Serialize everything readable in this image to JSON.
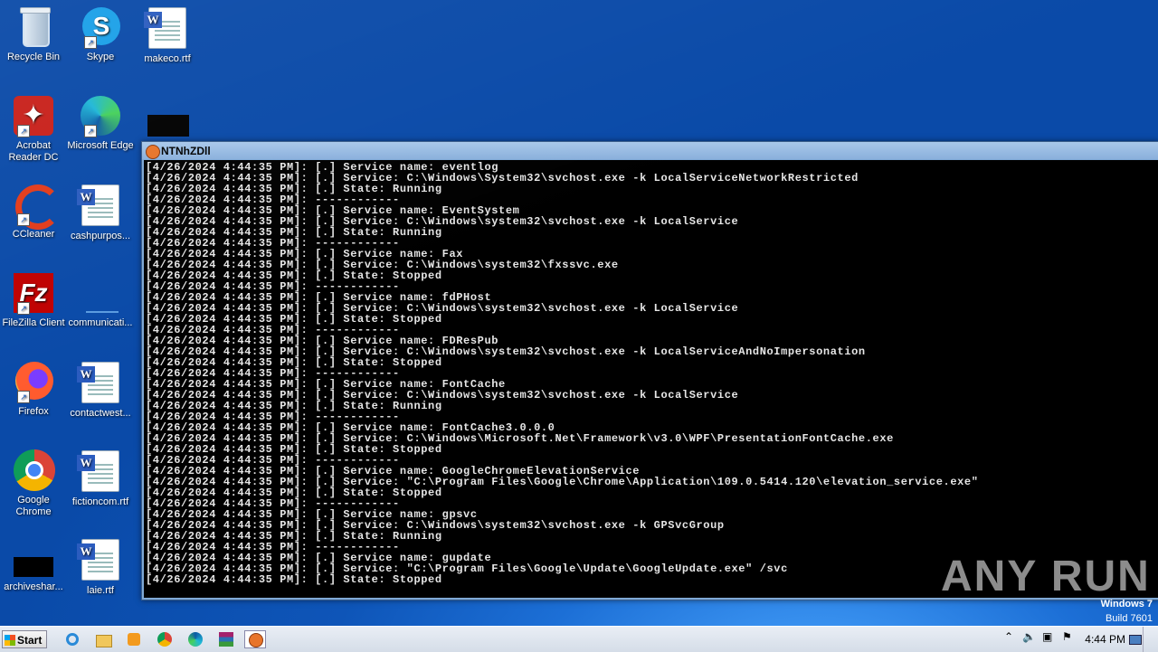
{
  "desktop_icons": {
    "recycle_bin": "Recycle Bin",
    "skype": "Skype",
    "makeco": "makeco.rtf",
    "acrobat": "Acrobat Reader DC",
    "edge": "Microsoft Edge",
    "ccleaner": "CCleaner",
    "cashpurpos": "cashpurpos...",
    "filezilla": "FileZilla Client",
    "communicati": "communicati...",
    "firefox": "Firefox",
    "contactwest": "contactwest...",
    "chrome": "Google Chrome",
    "fictioncom": "fictioncom.rtf",
    "archiveshar": "archiveshar...",
    "laie": "laie.rtf"
  },
  "window": {
    "title": "NTNhZDll",
    "console_text": "[4/26/2024 4:44:35 PM]: [.] Service name: eventlog\n[4/26/2024 4:44:35 PM]: [.] Service: C:\\Windows\\System32\\svchost.exe -k LocalServiceNetworkRestricted\n[4/26/2024 4:44:35 PM]: [.] State: Running\n[4/26/2024 4:44:35 PM]: ------------\n[4/26/2024 4:44:35 PM]: [.] Service name: EventSystem\n[4/26/2024 4:44:35 PM]: [.] Service: C:\\Windows\\system32\\svchost.exe -k LocalService\n[4/26/2024 4:44:35 PM]: [.] State: Running\n[4/26/2024 4:44:35 PM]: ------------\n[4/26/2024 4:44:35 PM]: [.] Service name: Fax\n[4/26/2024 4:44:35 PM]: [.] Service: C:\\Windows\\system32\\fxssvc.exe\n[4/26/2024 4:44:35 PM]: [.] State: Stopped\n[4/26/2024 4:44:35 PM]: ------------\n[4/26/2024 4:44:35 PM]: [.] Service name: fdPHost\n[4/26/2024 4:44:35 PM]: [.] Service: C:\\Windows\\system32\\svchost.exe -k LocalService\n[4/26/2024 4:44:35 PM]: [.] State: Stopped\n[4/26/2024 4:44:35 PM]: ------------\n[4/26/2024 4:44:35 PM]: [.] Service name: FDResPub\n[4/26/2024 4:44:35 PM]: [.] Service: C:\\Windows\\system32\\svchost.exe -k LocalServiceAndNoImpersonation\n[4/26/2024 4:44:35 PM]: [.] State: Stopped\n[4/26/2024 4:44:35 PM]: ------------\n[4/26/2024 4:44:35 PM]: [.] Service name: FontCache\n[4/26/2024 4:44:35 PM]: [.] Service: C:\\Windows\\system32\\svchost.exe -k LocalService\n[4/26/2024 4:44:35 PM]: [.] State: Running\n[4/26/2024 4:44:35 PM]: ------------\n[4/26/2024 4:44:35 PM]: [.] Service name: FontCache3.0.0.0\n[4/26/2024 4:44:35 PM]: [.] Service: C:\\Windows\\Microsoft.Net\\Framework\\v3.0\\WPF\\PresentationFontCache.exe\n[4/26/2024 4:44:35 PM]: [.] State: Stopped\n[4/26/2024 4:44:35 PM]: ------------\n[4/26/2024 4:44:35 PM]: [.] Service name: GoogleChromeElevationService\n[4/26/2024 4:44:35 PM]: [.] Service: \"C:\\Program Files\\Google\\Chrome\\Application\\109.0.5414.120\\elevation_service.exe\"\n[4/26/2024 4:44:35 PM]: [.] State: Stopped\n[4/26/2024 4:44:35 PM]: ------------\n[4/26/2024 4:44:35 PM]: [.] Service name: gpsvc\n[4/26/2024 4:44:35 PM]: [.] Service: C:\\Windows\\system32\\svchost.exe -k GPSvcGroup\n[4/26/2024 4:44:35 PM]: [.] State: Running\n[4/26/2024 4:44:35 PM]: ------------\n[4/26/2024 4:44:35 PM]: [.] Service name: gupdate\n[4/26/2024 4:44:35 PM]: [.] Service: \"C:\\Program Files\\Google\\Update\\GoogleUpdate.exe\" /svc\n[4/26/2024 4:44:35 PM]: [.] State: Stopped"
  },
  "watermark": {
    "os": "Windows 7",
    "build": "Build 7601",
    "brand": "ANY RUN"
  },
  "taskbar": {
    "start_label": "Start",
    "clock": "4:44 PM"
  }
}
